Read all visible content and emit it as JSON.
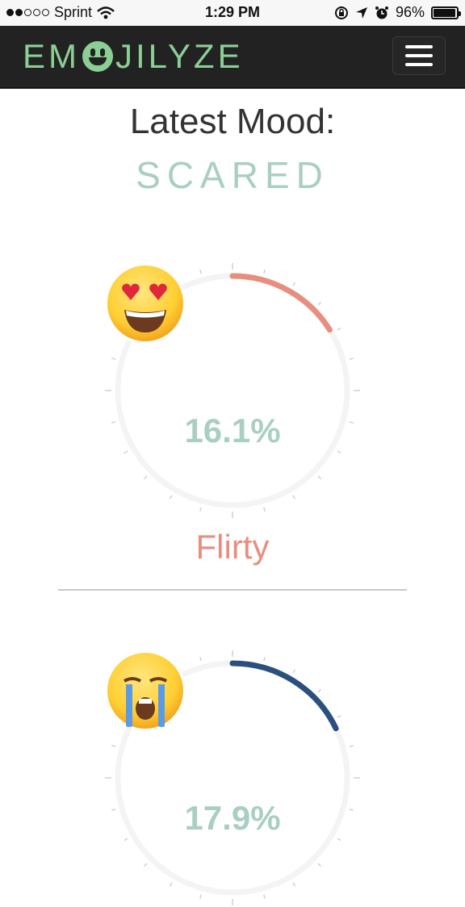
{
  "status": {
    "carrier": "Sprint",
    "signal_dots": [
      true,
      true,
      false,
      false,
      false
    ],
    "time": "1:29 PM",
    "battery": "96%",
    "battery_level": 0.96,
    "icons": [
      "wifi-icon",
      "rotation-lock-icon",
      "location-arrow-icon",
      "alarm-icon",
      "battery-icon"
    ]
  },
  "header": {
    "logo_left": "EM",
    "logo_right": "JILYZE",
    "logo_icon": "smiley-icon",
    "menu_icon": "hamburger-menu-icon"
  },
  "latest": {
    "label": "Latest Mood:",
    "mood": "SCARED"
  },
  "moods": [
    {
      "emoji": "heart-eyes-emoji",
      "percent": "16.1%",
      "fraction": 0.161,
      "name": "Flirty",
      "color": "#e88e7e"
    },
    {
      "emoji": "crying-emoji",
      "percent": "17.9%",
      "fraction": 0.179,
      "name": "",
      "color": "#2b4f7e"
    }
  ],
  "colors": {
    "accent": "#a9cfc1",
    "logo": "#8ccf95",
    "navbar": "#222222",
    "track": "#f4f4f4"
  }
}
